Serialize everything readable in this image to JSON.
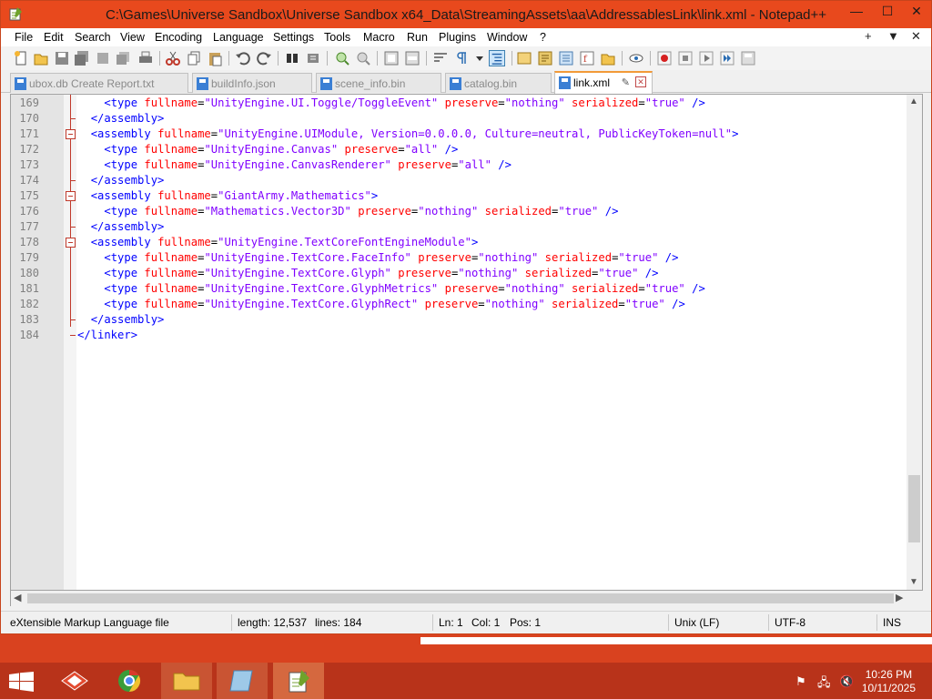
{
  "window": {
    "title": "C:\\Games\\Universe Sandbox\\Universe Sandbox x64_Data\\StreamingAssets\\aa\\AddressablesLink\\link.xml - Notepad++",
    "minimize": "—",
    "maximize": "☐",
    "close": "✕"
  },
  "menu": {
    "items": [
      "File",
      "Edit",
      "Search",
      "View",
      "Encoding",
      "Language",
      "Settings",
      "Tools",
      "Macro",
      "Run",
      "Plugins",
      "Window",
      "?"
    ],
    "right": [
      "+",
      "▼",
      "✕"
    ]
  },
  "tabs": [
    {
      "label": "ubox.db Create Report.txt",
      "active": false
    },
    {
      "label": "buildInfo.json",
      "active": false
    },
    {
      "label": "scene_info.bin",
      "active": false
    },
    {
      "label": "catalog.bin",
      "active": false
    },
    {
      "label": "link.xml",
      "active": true
    }
  ],
  "editor": {
    "lines": [
      {
        "n": "169",
        "parts": [
          [
            "",
            "    "
          ],
          [
            "tg",
            "<type "
          ],
          [
            "at",
            "fullname"
          ],
          [
            "eq",
            "="
          ],
          [
            "vl",
            "\"UnityEngine.UI.Toggle/ToggleEvent\""
          ],
          [
            "at",
            " preserve"
          ],
          [
            "eq",
            "="
          ],
          [
            "vl",
            "\"nothing\""
          ],
          [
            "at",
            " serialized"
          ],
          [
            "eq",
            "="
          ],
          [
            "vl",
            "\"true\""
          ],
          [
            "tg",
            " />"
          ]
        ]
      },
      {
        "n": "170",
        "parts": [
          [
            "",
            "  "
          ],
          [
            "tg",
            "</assembly>"
          ]
        ]
      },
      {
        "n": "171",
        "parts": [
          [
            "",
            "  "
          ],
          [
            "tg",
            "<assembly "
          ],
          [
            "at",
            "fullname"
          ],
          [
            "eq",
            "="
          ],
          [
            "vl",
            "\"UnityEngine.UIModule, Version=0.0.0.0, Culture=neutral, PublicKeyToken=null\""
          ],
          [
            "tg",
            ">"
          ]
        ]
      },
      {
        "n": "172",
        "parts": [
          [
            "",
            "    "
          ],
          [
            "tg",
            "<type "
          ],
          [
            "at",
            "fullname"
          ],
          [
            "eq",
            "="
          ],
          [
            "vl",
            "\"UnityEngine.Canvas\""
          ],
          [
            "at",
            " preserve"
          ],
          [
            "eq",
            "="
          ],
          [
            "vl",
            "\"all\""
          ],
          [
            "tg",
            " />"
          ]
        ]
      },
      {
        "n": "173",
        "parts": [
          [
            "",
            "    "
          ],
          [
            "tg",
            "<type "
          ],
          [
            "at",
            "fullname"
          ],
          [
            "eq",
            "="
          ],
          [
            "vl",
            "\"UnityEngine.CanvasRenderer\""
          ],
          [
            "at",
            " preserve"
          ],
          [
            "eq",
            "="
          ],
          [
            "vl",
            "\"all\""
          ],
          [
            "tg",
            " />"
          ]
        ]
      },
      {
        "n": "174",
        "parts": [
          [
            "",
            "  "
          ],
          [
            "tg",
            "</assembly>"
          ]
        ]
      },
      {
        "n": "175",
        "parts": [
          [
            "",
            "  "
          ],
          [
            "tg",
            "<assembly "
          ],
          [
            "at",
            "fullname"
          ],
          [
            "eq",
            "="
          ],
          [
            "vl",
            "\"GiantArmy.Mathematics\""
          ],
          [
            "tg",
            ">"
          ]
        ]
      },
      {
        "n": "176",
        "parts": [
          [
            "",
            "    "
          ],
          [
            "tg",
            "<type "
          ],
          [
            "at",
            "fullname"
          ],
          [
            "eq",
            "="
          ],
          [
            "vl",
            "\"Mathematics.Vector3D\""
          ],
          [
            "at",
            " preserve"
          ],
          [
            "eq",
            "="
          ],
          [
            "vl",
            "\"nothing\""
          ],
          [
            "at",
            " serialized"
          ],
          [
            "eq",
            "="
          ],
          [
            "vl",
            "\"true\""
          ],
          [
            "tg",
            " />"
          ]
        ]
      },
      {
        "n": "177",
        "parts": [
          [
            "",
            "  "
          ],
          [
            "tg",
            "</assembly>"
          ]
        ]
      },
      {
        "n": "178",
        "parts": [
          [
            "",
            "  "
          ],
          [
            "tg",
            "<assembly "
          ],
          [
            "at",
            "fullname"
          ],
          [
            "eq",
            "="
          ],
          [
            "vl",
            "\"UnityEngine.TextCoreFontEngineModule\""
          ],
          [
            "tg",
            ">"
          ]
        ]
      },
      {
        "n": "179",
        "parts": [
          [
            "",
            "    "
          ],
          [
            "tg",
            "<type "
          ],
          [
            "at",
            "fullname"
          ],
          [
            "eq",
            "="
          ],
          [
            "vl",
            "\"UnityEngine.TextCore.FaceInfo\""
          ],
          [
            "at",
            " preserve"
          ],
          [
            "eq",
            "="
          ],
          [
            "vl",
            "\"nothing\""
          ],
          [
            "at",
            " serialized"
          ],
          [
            "eq",
            "="
          ],
          [
            "vl",
            "\"true\""
          ],
          [
            "tg",
            " />"
          ]
        ]
      },
      {
        "n": "180",
        "parts": [
          [
            "",
            "    "
          ],
          [
            "tg",
            "<type "
          ],
          [
            "at",
            "fullname"
          ],
          [
            "eq",
            "="
          ],
          [
            "vl",
            "\"UnityEngine.TextCore.Glyph\""
          ],
          [
            "at",
            " preserve"
          ],
          [
            "eq",
            "="
          ],
          [
            "vl",
            "\"nothing\""
          ],
          [
            "at",
            " serialized"
          ],
          [
            "eq",
            "="
          ],
          [
            "vl",
            "\"true\""
          ],
          [
            "tg",
            " />"
          ]
        ]
      },
      {
        "n": "181",
        "parts": [
          [
            "",
            "    "
          ],
          [
            "tg",
            "<type "
          ],
          [
            "at",
            "fullname"
          ],
          [
            "eq",
            "="
          ],
          [
            "vl",
            "\"UnityEngine.TextCore.GlyphMetrics\""
          ],
          [
            "at",
            " preserve"
          ],
          [
            "eq",
            "="
          ],
          [
            "vl",
            "\"nothing\""
          ],
          [
            "at",
            " serialized"
          ],
          [
            "eq",
            "="
          ],
          [
            "vl",
            "\"true\""
          ],
          [
            "tg",
            " />"
          ]
        ]
      },
      {
        "n": "182",
        "parts": [
          [
            "",
            "    "
          ],
          [
            "tg",
            "<type "
          ],
          [
            "at",
            "fullname"
          ],
          [
            "eq",
            "="
          ],
          [
            "vl",
            "\"UnityEngine.TextCore.GlyphRect\""
          ],
          [
            "at",
            " preserve"
          ],
          [
            "eq",
            "="
          ],
          [
            "vl",
            "\"nothing\""
          ],
          [
            "at",
            " serialized"
          ],
          [
            "eq",
            "="
          ],
          [
            "vl",
            "\"true\""
          ],
          [
            "tg",
            " />"
          ]
        ]
      },
      {
        "n": "183",
        "parts": [
          [
            "",
            "  "
          ],
          [
            "tg",
            "</assembly>"
          ]
        ]
      },
      {
        "n": "184",
        "parts": [
          [
            "tg",
            "</linker>"
          ]
        ]
      }
    ]
  },
  "status": {
    "file_type": "eXtensible Markup Language file",
    "length": "length: 12,537",
    "lines": "lines: 184",
    "ln": "Ln: 1",
    "col": "Col: 1",
    "pos": "Pos: 1",
    "eol": "Unix (LF)",
    "encoding": "UTF-8",
    "mode": "INS"
  },
  "taskbar": {
    "time": "10:26 PM",
    "date": "10/11/2025"
  },
  "colors": {
    "accent": "#e8491d",
    "tag": "#0000ff",
    "attribute": "#ff0000",
    "value": "#8000ff"
  }
}
